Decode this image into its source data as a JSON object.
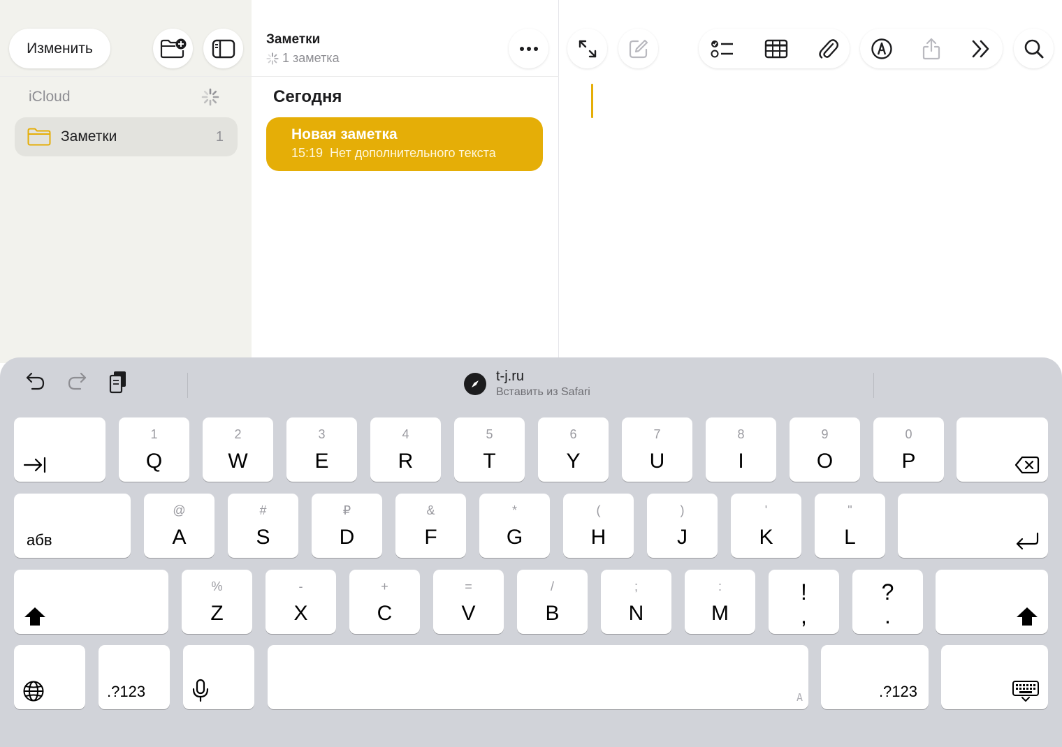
{
  "sidebar": {
    "edit_label": "Изменить",
    "account_label": "iCloud",
    "folder": {
      "label": "Заметки",
      "count": "1"
    }
  },
  "list": {
    "title": "Заметки",
    "subtitle": "1 заметка",
    "section": "Сегодня",
    "note": {
      "title": "Новая заметка",
      "time": "15:19",
      "preview": "Нет дополнительного текста"
    }
  },
  "keyboard": {
    "suggestion": {
      "main": "t-j.ru",
      "sub": "Вставить из Safari"
    },
    "row1": [
      {
        "alt": "1",
        "main": "Q"
      },
      {
        "alt": "2",
        "main": "W"
      },
      {
        "alt": "3",
        "main": "E"
      },
      {
        "alt": "4",
        "main": "R"
      },
      {
        "alt": "5",
        "main": "T"
      },
      {
        "alt": "6",
        "main": "Y"
      },
      {
        "alt": "7",
        "main": "U"
      },
      {
        "alt": "8",
        "main": "I"
      },
      {
        "alt": "9",
        "main": "O"
      },
      {
        "alt": "0",
        "main": "P"
      }
    ],
    "row2": [
      {
        "alt": "@",
        "main": "A"
      },
      {
        "alt": "#",
        "main": "S"
      },
      {
        "alt": "₽",
        "main": "D"
      },
      {
        "alt": "&",
        "main": "F"
      },
      {
        "alt": "*",
        "main": "G"
      },
      {
        "alt": "(",
        "main": "H"
      },
      {
        "alt": ")",
        "main": "J"
      },
      {
        "alt": "'",
        "main": "K"
      },
      {
        "alt": "\"",
        "main": "L"
      }
    ],
    "row3": [
      {
        "alt": "%",
        "main": "Z"
      },
      {
        "alt": "-",
        "main": "X"
      },
      {
        "alt": "+",
        "main": "C"
      },
      {
        "alt": "=",
        "main": "V"
      },
      {
        "alt": "/",
        "main": "B"
      },
      {
        "alt": ";",
        "main": "N"
      },
      {
        "alt": ":",
        "main": "M"
      }
    ],
    "punct": [
      {
        "top": "!",
        "bot": ","
      },
      {
        "top": "?",
        "bot": "."
      }
    ],
    "lang_label": "абв",
    "num_label": ".?123",
    "space_hint": "A"
  },
  "colors": {
    "accent": "#e5ae07",
    "keyboard_bg": "#d1d3d9",
    "sidebar_bg": "#f2f2ed"
  }
}
